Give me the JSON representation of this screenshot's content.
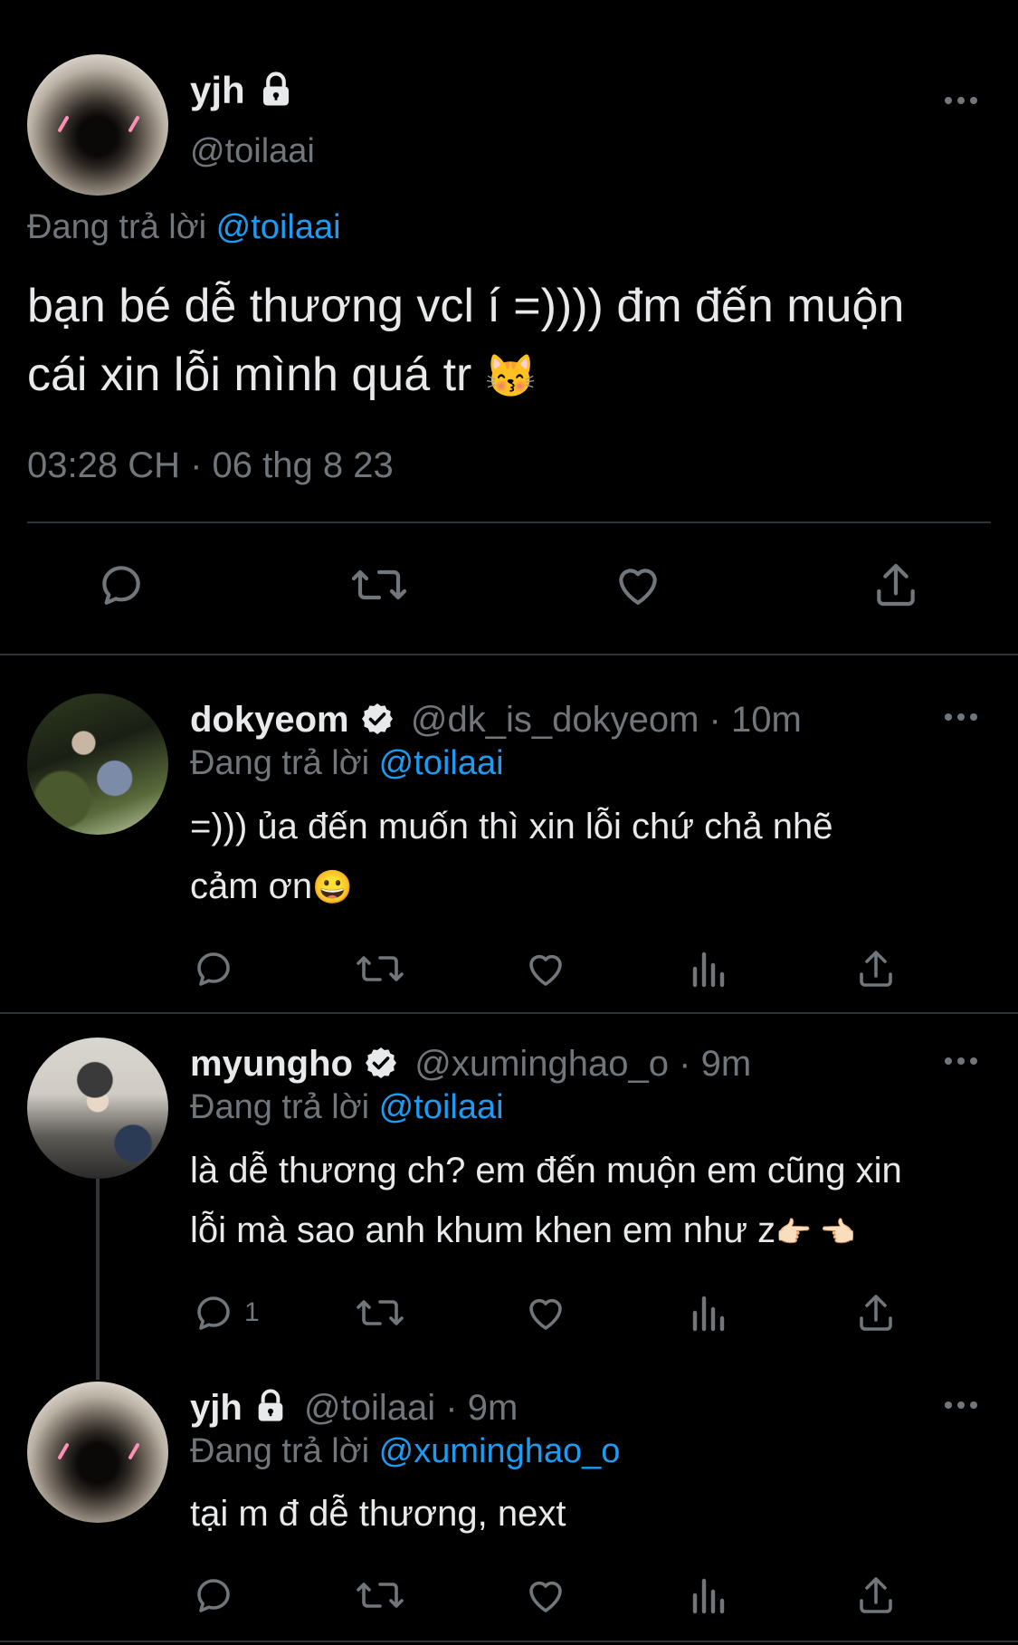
{
  "main_tweet": {
    "display_name": "yjh",
    "handle": "@toilaai",
    "reply_prefix": "Đang trả lời",
    "reply_to": "@toilaai",
    "text_line1": "bạn bé dễ thương vcl í =)))) đm đến muộn",
    "text_line2": "cái xin lỗi mình quá tr",
    "emoji": "😽",
    "timestamp": "03:28 CH · 06 thg 8 23"
  },
  "replies": [
    {
      "display_name": "dokyeom",
      "handle": "@dk_is_dokyeom",
      "time": "· 10m",
      "reply_prefix": "Đang trả lời",
      "reply_to": "@toilaai",
      "text_line1": "=))) ủa đến muốn thì xin lỗi chứ chả nhẽ",
      "text_line2": "cảm ơn",
      "emoji": "😀",
      "reply_count": ""
    },
    {
      "display_name": "myungho",
      "handle": "@xuminghao_o",
      "time": "· 9m",
      "reply_prefix": "Đang trả lời",
      "reply_to": "@toilaai",
      "text_line1": "là dễ thương ch? em đến muộn em cũng xin",
      "text_line2": "lỗi mà sao anh khum khen em như z",
      "emoji": "👉🏻 👈🏻",
      "reply_count": "1"
    },
    {
      "display_name": "yjh",
      "handle": "@toilaai",
      "time": "· 9m",
      "reply_prefix": "Đang trả lời",
      "reply_to": "@xuminghao_o",
      "text_line1": "tại m đ dễ thương, next",
      "reply_count": ""
    }
  ],
  "colors": {
    "background": "#000000",
    "text": "#e7e9ea",
    "muted": "#71767b",
    "link": "#1d9bf0",
    "divider": "#2f3336"
  },
  "icons": [
    "reply-icon",
    "retweet-icon",
    "like-icon",
    "views-icon",
    "share-icon",
    "more-icon",
    "lock-icon",
    "verified-icon"
  ]
}
